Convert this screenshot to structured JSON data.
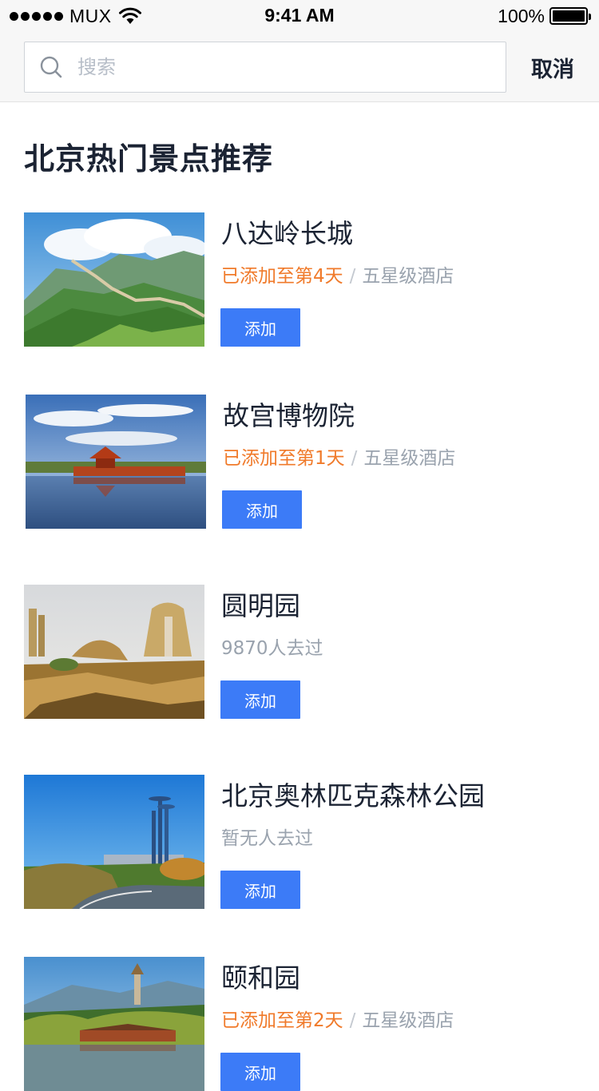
{
  "status_bar": {
    "carrier": "MUX",
    "time": "9:41 AM",
    "battery": "100%"
  },
  "search": {
    "placeholder": "搜索",
    "value": "",
    "cancel_label": "取消"
  },
  "section_title": "北京热门景点推荐",
  "spots": [
    {
      "name": "八达岭长城",
      "added": "已添加至第4天",
      "hotel": "五星级酒店",
      "visitors": "",
      "add_label": "添加"
    },
    {
      "name": "故宫博物院",
      "added": "已添加至第1天",
      "hotel": "五星级酒店",
      "visitors": "",
      "add_label": "添加"
    },
    {
      "name": "圆明园",
      "added": "",
      "hotel": "",
      "visitors": "9870人去过",
      "add_label": "添加"
    },
    {
      "name": "北京奥林匹克森林公园",
      "added": "",
      "hotel": "",
      "visitors": "暂无人去过",
      "add_label": "添加"
    },
    {
      "name": "颐和园",
      "added": "已添加至第2天",
      "hotel": "五星级酒店",
      "visitors": "",
      "add_label": "添加"
    }
  ],
  "colors": {
    "accent": "#3c7bf7",
    "added_text": "#f07a2a",
    "muted_text": "#9aa3ae",
    "title_text": "#1b2333"
  }
}
